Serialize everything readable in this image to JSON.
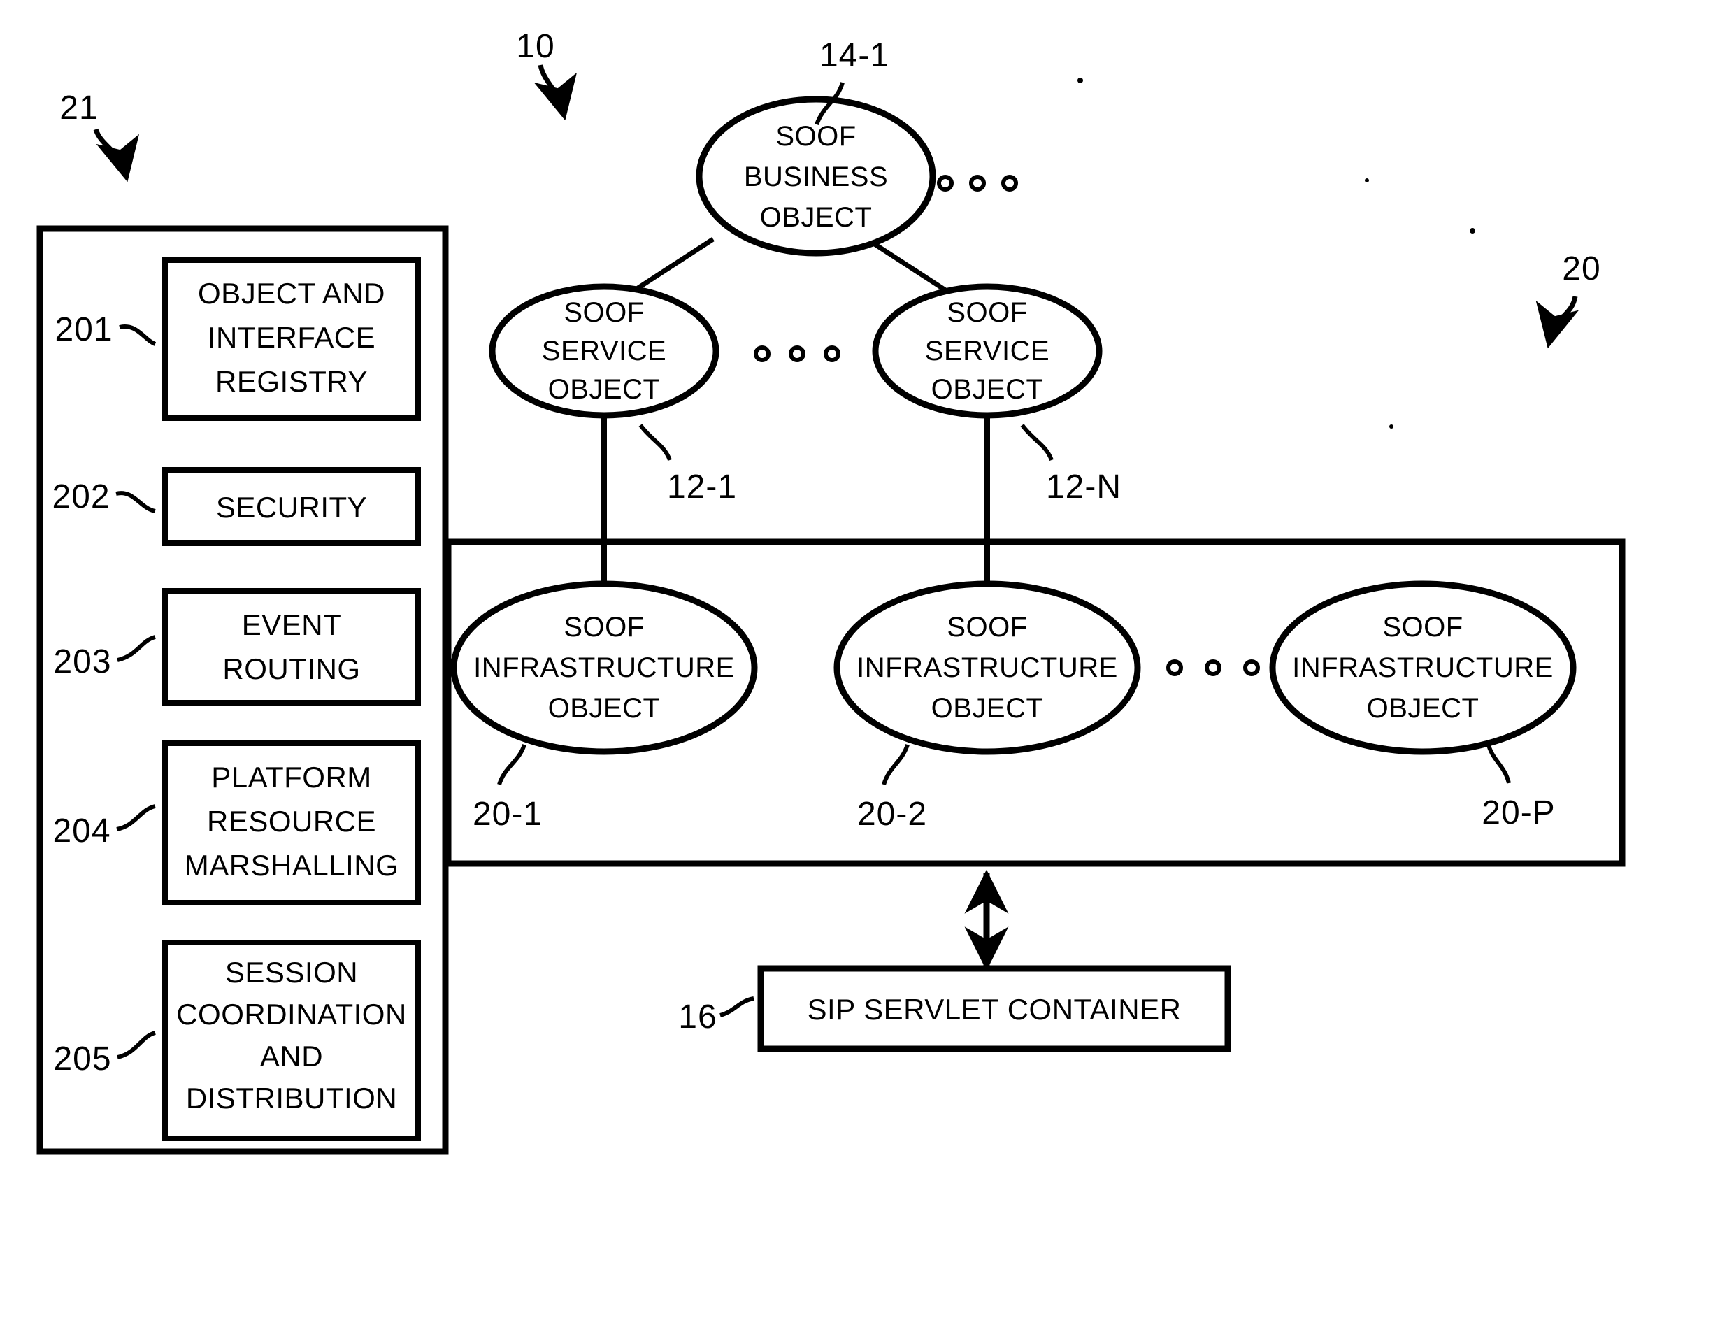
{
  "figure": {
    "title": "SOOF architecture block diagram",
    "background_color": "#ffffff",
    "line_color": "#000000"
  },
  "reference_numerals": {
    "framework": "10",
    "left_panel": "21",
    "right_panel": "20",
    "business_object": "14-1",
    "service_object_first": "12-1",
    "service_object_last": "12-N",
    "infrastructure_object_first": "20-1",
    "infrastructure_object_second": "20-2",
    "infrastructure_object_last": "20-P",
    "sip_container": "16"
  },
  "left_panel": {
    "ref": "21",
    "items": [
      {
        "ref": "201",
        "label": "OBJECT AND\nINTERFACE\nREGISTRY",
        "lines": [
          "OBJECT AND",
          "INTERFACE",
          "REGISTRY"
        ]
      },
      {
        "ref": "202",
        "label": "SECURITY",
        "lines": [
          "SECURITY"
        ]
      },
      {
        "ref": "203",
        "label": "EVENT\nROUTING",
        "lines": [
          "EVENT",
          "ROUTING"
        ]
      },
      {
        "ref": "204",
        "label": "PLATFORM\nRESOURCE\nMARSHALLING",
        "lines": [
          "PLATFORM",
          "RESOURCE",
          "MARSHALLING"
        ]
      },
      {
        "ref": "205",
        "label": "SESSION\nCOORDINATION\nAND\nDISTRIBUTION",
        "lines": [
          "SESSION",
          "COORDINATION",
          "AND",
          "DISTRIBUTION"
        ]
      }
    ]
  },
  "business_layer": {
    "node": {
      "ref": "14-1",
      "lines": [
        "SOOF",
        "BUSINESS",
        "OBJECT"
      ]
    },
    "ellipsis": "o o o"
  },
  "service_layer": {
    "nodes": [
      {
        "ref": "12-1",
        "lines": [
          "SOOF",
          "SERVICE",
          "OBJECT"
        ]
      },
      {
        "ref": "12-N",
        "lines": [
          "SOOF",
          "SERVICE",
          "OBJECT"
        ]
      }
    ],
    "ellipsis": "o o o"
  },
  "infrastructure_layer": {
    "ref": "20",
    "nodes": [
      {
        "ref": "20-1",
        "lines": [
          "SOOF",
          "INFRASTRUCTURE",
          "OBJECT"
        ]
      },
      {
        "ref": "20-2",
        "lines": [
          "SOOF",
          "INFRASTRUCTURE",
          "OBJECT"
        ]
      },
      {
        "ref": "20-P",
        "lines": [
          "SOOF",
          "INFRASTRUCTURE",
          "OBJECT"
        ]
      }
    ],
    "ellipsis": "o o o"
  },
  "sip_container": {
    "ref": "16",
    "label": "SIP SERVLET CONTAINER"
  }
}
